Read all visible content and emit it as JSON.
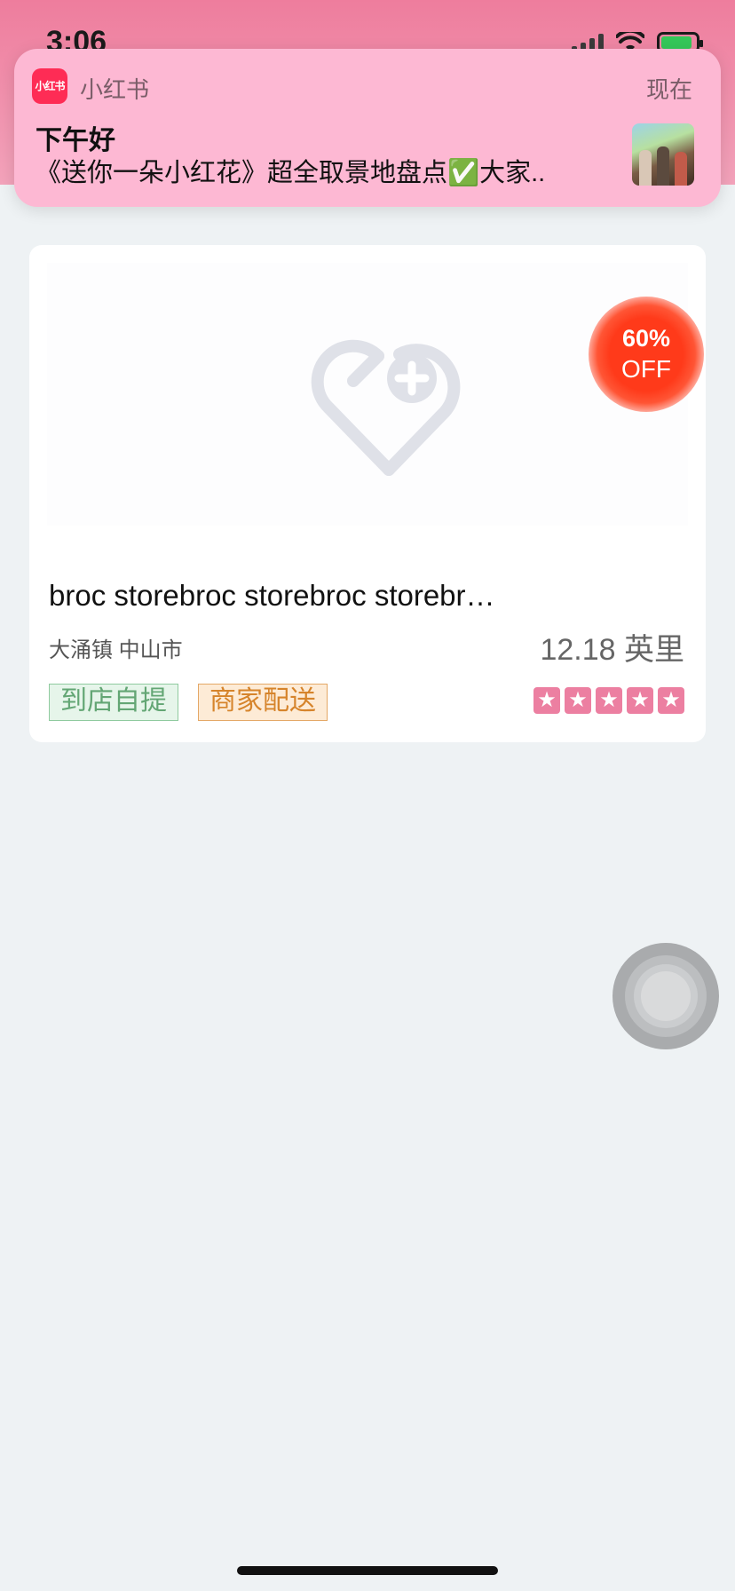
{
  "status_bar": {
    "time": "3:06",
    "icons": [
      "location-arrow-icon",
      "cellular-signal-icon",
      "wifi-icon",
      "battery-charging-icon"
    ]
  },
  "notification": {
    "app_name": "小红书",
    "app_icon_text": "小红书",
    "time": "现在",
    "title": "下午好",
    "body": "《送你一朵小红花》超全取景地盘点✅大家..",
    "thumbnail": "movie-poster-thumbnail"
  },
  "store_card": {
    "image_placeholder_icon": "heart-plus-icon",
    "discount": {
      "percent": "60%",
      "label": "OFF"
    },
    "name": "broc storebroc storebroc storebroc store",
    "location": "大涌镇 中山市",
    "distance": "12.18 英里",
    "tags": [
      "到店自提",
      "商家配送"
    ],
    "rating": {
      "stars": 5,
      "max": 5,
      "star_icon": "star-icon"
    },
    "colors": {
      "pickup_tag": "#63a674",
      "delivery_tag": "#d6842b",
      "star_bg": "#ec7fa1",
      "discount_badge": "#ff3a1a"
    }
  },
  "assistive_touch": {
    "icon": "assistive-touch-icon"
  },
  "colors": {
    "header_pink": "#ee7d9d",
    "notification_bg": "#fdb8d3",
    "page_bg": "#eef2f4"
  }
}
